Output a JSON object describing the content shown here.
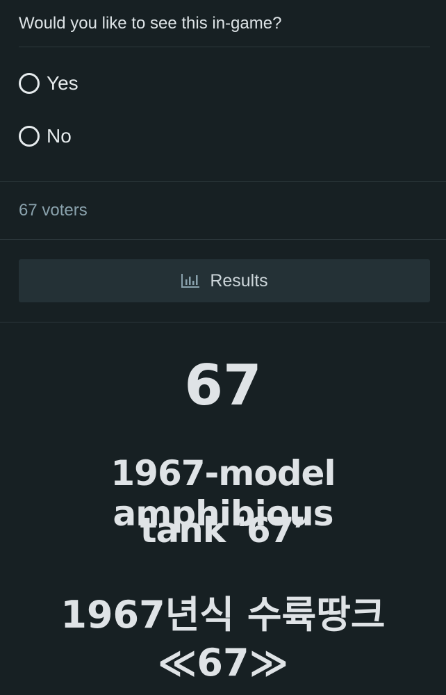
{
  "poll": {
    "question": "Would you like to see this in-game?",
    "options": [
      {
        "label": "Yes"
      },
      {
        "label": "No"
      }
    ],
    "voters": "67 voters",
    "results_label": "Results"
  },
  "image_text": {
    "number": "67",
    "english_line1": "1967-model amphibious",
    "english_line2": "tank '67’",
    "korean_line1": "1967년식 수륙땅크",
    "korean_line2": "≪67≫"
  },
  "colors": {
    "background": "#172023",
    "button": "#243136",
    "muted_text": "#8aa2ad"
  }
}
